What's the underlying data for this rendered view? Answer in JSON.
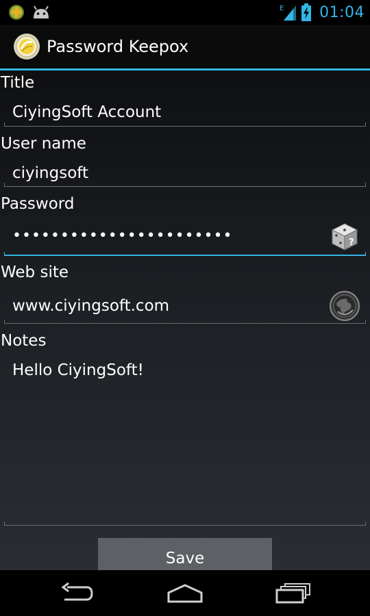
{
  "status_bar": {
    "time": "01:04",
    "network_type": "E",
    "left_icons": [
      "plus-notification-icon",
      "android-icon"
    ],
    "right_icons": [
      "signal-icon",
      "battery-charging-icon"
    ]
  },
  "action_bar": {
    "title": "Password Keepox",
    "icon": "app-logo-icon"
  },
  "form": {
    "title": {
      "label": "Title",
      "value": "CiyingSoft Account"
    },
    "username": {
      "label": "User name",
      "value": "ciyingsoft"
    },
    "password": {
      "label": "Password",
      "value": "•••••••••••••••••••••••",
      "icon": "generate-password-dice-icon"
    },
    "website": {
      "label": "Web site",
      "value": "www.ciyingsoft.com",
      "icon": "open-website-globe-icon"
    },
    "notes": {
      "label": "Notes",
      "value": "Hello CiyingSoft!"
    }
  },
  "save_button": {
    "label": "Save"
  },
  "nav_bar": {
    "icons": [
      "back-icon",
      "home-icon",
      "recent-apps-icon"
    ]
  },
  "colors": {
    "accent": "#33b5e5",
    "text": "#ffffff",
    "button": "#5d6064"
  }
}
